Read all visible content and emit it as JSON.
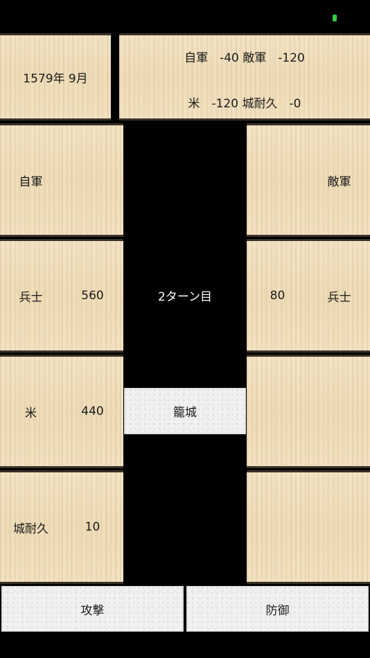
{
  "status": {
    "battery_color": "#2ecc40"
  },
  "header": {
    "date": "1579年 9月",
    "line1": "自軍　-40 敵軍　-120",
    "line2": "米　-120 城耐久　-0"
  },
  "own": {
    "title": "自軍",
    "soldiers_label": "兵士",
    "soldiers_value": "560",
    "rice_label": "米",
    "rice_value": "440",
    "castle_label": "城耐久",
    "castle_value": "10"
  },
  "enemy": {
    "title": "敵軍",
    "soldiers_label": "兵士",
    "soldiers_value": "80"
  },
  "center": {
    "turn": "2ターン目",
    "siege_button": "籠城"
  },
  "actions": {
    "attack": "攻撃",
    "defend": "防御"
  }
}
